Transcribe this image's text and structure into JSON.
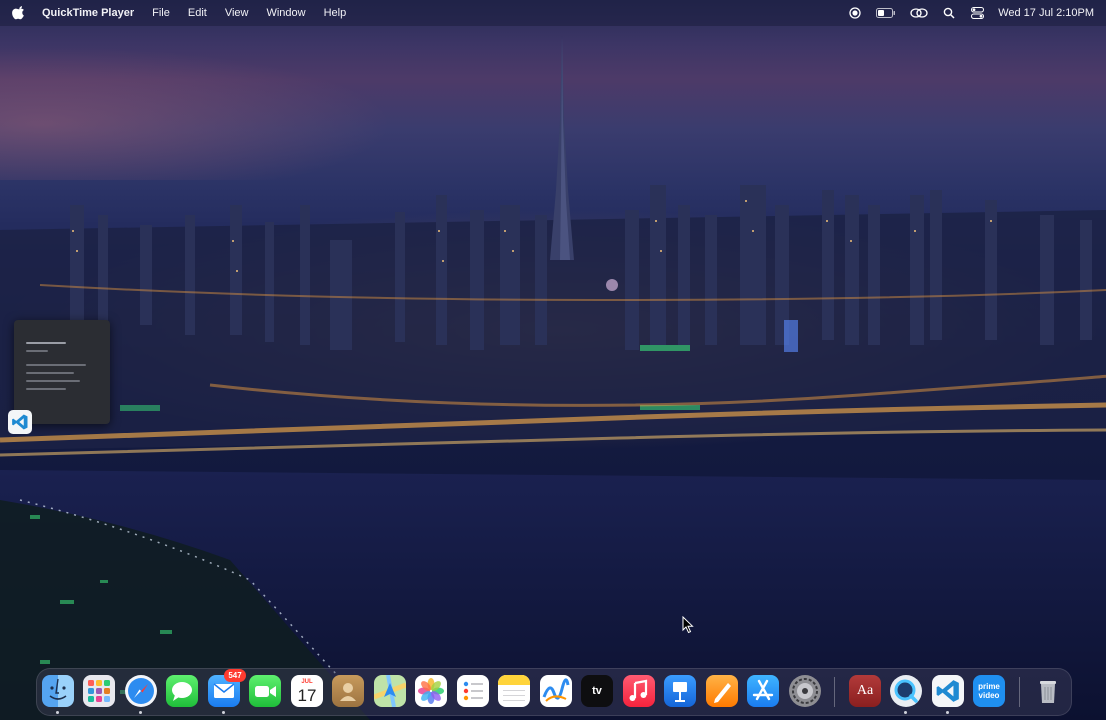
{
  "menubar": {
    "app_name": "QuickTime Player",
    "items": [
      {
        "label": "File"
      },
      {
        "label": "Edit"
      },
      {
        "label": "View"
      },
      {
        "label": "Window"
      },
      {
        "label": "Help"
      }
    ],
    "status_icons": [
      "screen-record-icon",
      "battery-icon",
      "screen-mirror-icon",
      "search-icon",
      "control-center-icon"
    ],
    "clock": "Wed 17 Jul  2:10PM"
  },
  "desktop": {
    "wallpaper": "night-city-skyline",
    "icons": [
      "vscode-icon"
    ]
  },
  "dock": {
    "apps": [
      {
        "name": "Finder",
        "icon": "finder-icon",
        "running": true
      },
      {
        "name": "Launchpad",
        "icon": "launchpad-icon",
        "running": false
      },
      {
        "name": "Safari",
        "icon": "safari-icon",
        "running": true
      },
      {
        "name": "Messages",
        "icon": "messages-icon",
        "running": false
      },
      {
        "name": "Mail",
        "icon": "mail-icon",
        "running": true,
        "badge": "547"
      },
      {
        "name": "FaceTime",
        "icon": "facetime-icon",
        "running": false
      },
      {
        "name": "Calendar",
        "icon": "calendar-icon",
        "running": false,
        "month": "JUL",
        "day": "17"
      },
      {
        "name": "Contacts",
        "icon": "contacts-icon",
        "running": false
      },
      {
        "name": "Maps",
        "icon": "maps-icon",
        "running": false
      },
      {
        "name": "Photos",
        "icon": "photos-icon",
        "running": false
      },
      {
        "name": "Reminders",
        "icon": "reminders-icon",
        "running": false
      },
      {
        "name": "Notes",
        "icon": "notes-icon",
        "running": false
      },
      {
        "name": "Freeform",
        "icon": "freeform-icon",
        "running": false
      },
      {
        "name": "TV",
        "icon": "apple-tv-icon",
        "running": false,
        "label": "tv"
      },
      {
        "name": "Music",
        "icon": "music-icon",
        "running": false
      },
      {
        "name": "Keynote",
        "icon": "keynote-icon",
        "running": false
      },
      {
        "name": "Pages",
        "icon": "pages-icon",
        "running": false
      },
      {
        "name": "App Store",
        "icon": "app-store-icon",
        "running": false
      },
      {
        "name": "System Settings",
        "icon": "system-settings-icon",
        "running": false
      },
      {
        "name": "Dictionary",
        "icon": "dictionary-icon",
        "running": false,
        "label": "Aa"
      },
      {
        "name": "QuickTime Player",
        "icon": "quicktime-icon",
        "running": true
      },
      {
        "name": "Visual Studio Code",
        "icon": "vscode-icon",
        "running": true
      },
      {
        "name": "Prime Video",
        "icon": "prime-video-icon",
        "running": false,
        "label_top": "prime",
        "label_bottom": "video"
      },
      {
        "name": "Trash",
        "icon": "trash-icon",
        "running": false
      }
    ]
  }
}
